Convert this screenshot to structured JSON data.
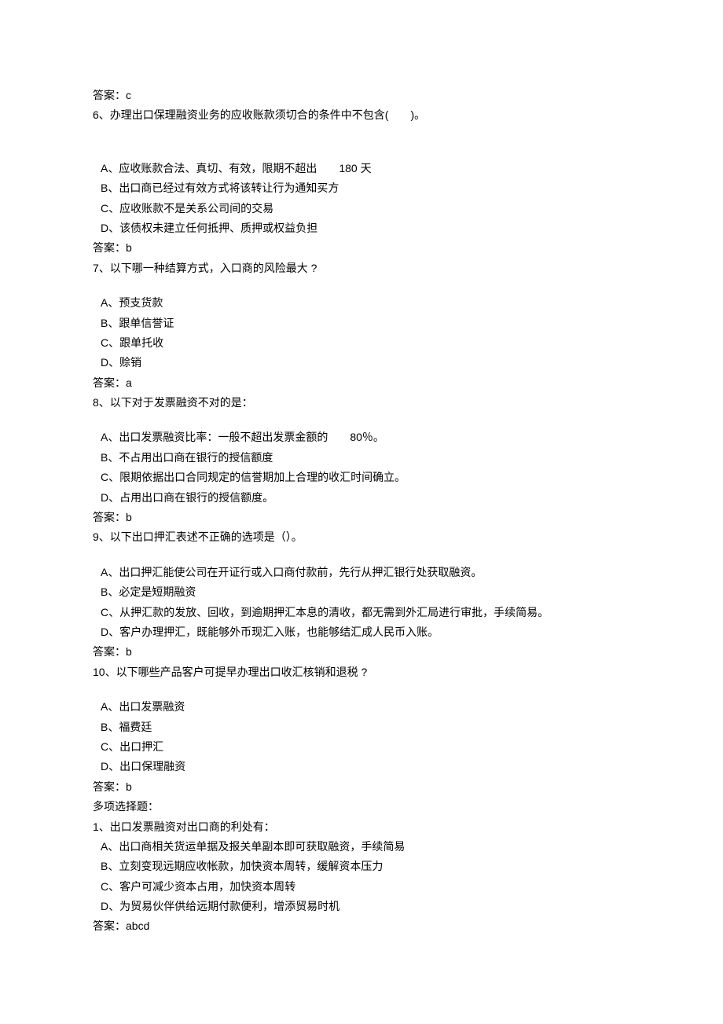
{
  "pre_answer": "答案：c",
  "q6": {
    "text": "6、办理出口保理融资业务的应收账款须切合的条件中不包含(　　)。",
    "A": "A、应收账款合法、真切、有效，限期不超出　　180 天",
    "B": "B、出口商已经过有效方式将该转让行为通知买方",
    "C": "C、应收账款不是关系公司间的交易",
    "D": "D、该债权未建立任何抵押、质押或权益负担",
    "ans": "答案：b"
  },
  "q7": {
    "text": "7、以下哪一种结算方式，入口商的风险最大 ?",
    "A": "A、预支货款",
    "B": "B、跟单信誉证",
    "C": "C、跟单托收",
    "D": "D、赊销",
    "ans": "答案：a"
  },
  "q8": {
    "text": "8、以下对于发票融资不对的是：",
    "A": "A、出口发票融资比率：一般不超出发票金额的　　80％。",
    "B": "B、不占用出口商在银行的授信额度",
    "C": "C、限期依据出口合同规定的信誉期加上合理的收汇时间确立。",
    "D": "D、占用出口商在银行的授信额度。",
    "ans": "答案：b"
  },
  "q9": {
    "text": "9、以下出口押汇表述不正确的选项是（）。",
    "A": "A、出口押汇能使公司在开证行或入口商付款前，先行从押汇银行处获取融资。",
    "B": "B、必定是短期融资",
    "C": "C、从押汇款的发放、回收，到逾期押汇本息的清收，都无需到外汇局进行审批，手续简易。",
    "D": "D、客户办理押汇，既能够外币现汇入账，也能够结汇成人民币入账。",
    "ans": "答案：b"
  },
  "q10": {
    "text": "10、以下哪些产品客户可提早办理出口收汇核销和退税 ?",
    "A": "A、出口发票融资",
    "B": "B、福费廷",
    "C": "C、出口押汇",
    "D": "D、出口保理融资",
    "ans": "答案：b"
  },
  "multi_header": "多项选择题：",
  "m1": {
    "text": "1、出口发票融资对出口商的利处有：",
    "A": "A、出口商相关货运单据及报关单副本即可获取融资，手续简易",
    "B": "B、立刻变现远期应收帐款，加快资本周转，缓解资本压力",
    "C": "C、客户可减少资本占用，加快资本周转",
    "D": "D、为贸易伙伴供给远期付款便利，增添贸易时机",
    "ans": "答案：abcd"
  }
}
